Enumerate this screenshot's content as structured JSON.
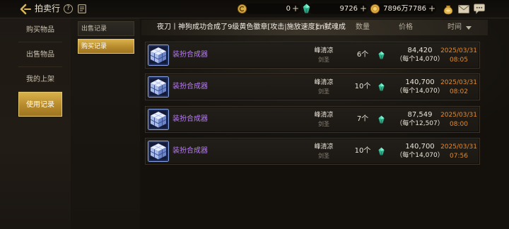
{
  "topbar": {
    "back_icon": "back-arrow-icon",
    "title": "拍卖行",
    "help_glyph": "?",
    "record_icon": "document-icon",
    "currencies": [
      {
        "icon": "c-coin-icon",
        "value": "0",
        "plus": "+"
      },
      {
        "icon": "green-gem-icon",
        "value": "9726",
        "plus": "+"
      },
      {
        "icon": "gold-coin-icon",
        "value": "7896万7786",
        "plus": "+"
      }
    ],
    "right_icons": [
      "gold-pouch-icon",
      "mail-icon",
      "chat-icon"
    ]
  },
  "sidebar": {
    "items": [
      {
        "label": "购买物品",
        "selected": false
      },
      {
        "label": "出售物品",
        "selected": false
      },
      {
        "label": "我的上架",
        "selected": false
      },
      {
        "label": "使用记录",
        "selected": true
      }
    ]
  },
  "subtabs": [
    {
      "label": "出售记录",
      "selected": false
    },
    {
      "label": "购买记录",
      "selected": true
    }
  ],
  "banner": {
    "message": "夜刀丨神狗成功合成了9级黄色徽章[攻击|施放速度]",
    "next_message": "cn弑魂成"
  },
  "table": {
    "headers": {
      "role": "角色",
      "quantity": "数量",
      "price": "价格",
      "time": "时间"
    },
    "sort_icon": "sort-down-icon",
    "rows": [
      {
        "item": "装扮合成器",
        "item_icon": "synthesizer-box-icon",
        "seller": "峰清凉",
        "class": "剑圣",
        "quantity": "6个",
        "price": "84,420",
        "unit_price": "（每个14,070）",
        "date": "2025/03/31",
        "time": "08:05"
      },
      {
        "item": "装扮合成器",
        "item_icon": "synthesizer-box-icon",
        "seller": "峰清凉",
        "class": "剑圣",
        "quantity": "10个",
        "price": "140,700",
        "unit_price": "（每个14,070）",
        "date": "2025/03/31",
        "time": "08:02"
      },
      {
        "item": "装扮合成器",
        "item_icon": "synthesizer-box-icon",
        "seller": "峰清凉",
        "class": "剑圣",
        "quantity": "7个",
        "price": "87,549",
        "unit_price": "（每个12,507）",
        "date": "2025/03/31",
        "time": "08:00"
      },
      {
        "item": "装扮合成器",
        "item_icon": "synthesizer-box-icon",
        "seller": "峰清凉",
        "class": "剑圣",
        "quantity": "10个",
        "price": "140,700",
        "unit_price": "（每个14,070）",
        "date": "2025/03/31",
        "time": "07:56"
      }
    ]
  },
  "colors": {
    "accent_gold": "#c9a03c",
    "item_purple": "#b57cf0",
    "time_orange": "#e48a2c",
    "gem_green": "#3fcaa0",
    "text_light": "#e6e0d2"
  }
}
